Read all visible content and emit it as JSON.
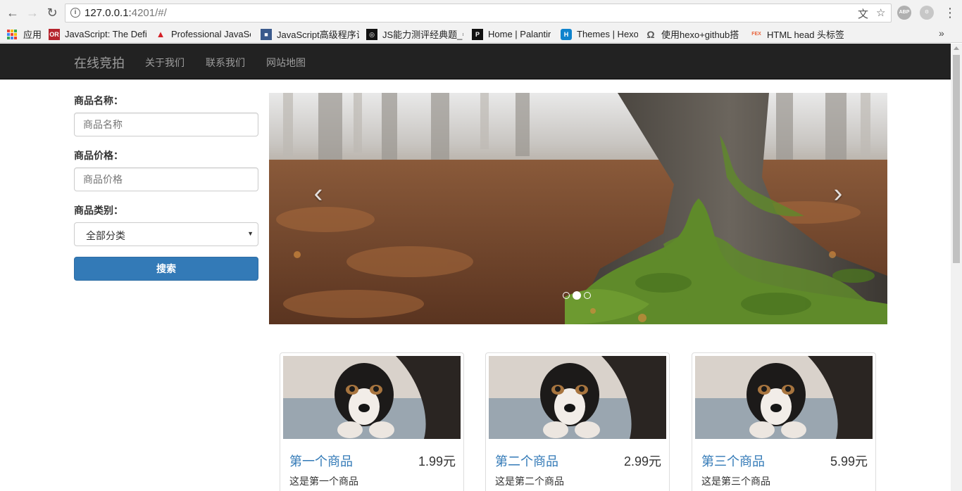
{
  "browser": {
    "url_host": "127.0.0.1:",
    "url_rest": "4201/#/",
    "bookmarks": [
      {
        "label": "应用",
        "icon": "apps-grid-icon"
      },
      {
        "label": "JavaScript: The Defi",
        "icon": "oreilly-icon",
        "color": "#b5242d"
      },
      {
        "label": "Professional JavaSc",
        "icon": "wrox-icon",
        "color": "#d42027"
      },
      {
        "label": "JavaScript高级程序设",
        "icon": "book-icon",
        "color": "#3a5a8c"
      },
      {
        "label": "JS能力测评经典题_牛",
        "icon": "nowcoder-icon",
        "color": "#111111"
      },
      {
        "label": "Home | Palantir",
        "icon": "palantir-icon",
        "color": "#111111"
      },
      {
        "label": "Themes | Hexo",
        "icon": "hexo-icon",
        "color": "#0e83cd"
      },
      {
        "label": "使用hexo+github搭",
        "icon": "omega-icon",
        "color": "#555555"
      },
      {
        "label": "HTML head 头标签",
        "icon": "fex-icon",
        "color": "#e8643c"
      }
    ],
    "fav_text": {
      "oreilly": "OR",
      "palantir": "P",
      "hexo": "H",
      "fex": "FEX",
      "nowcoder": "◎"
    },
    "ext_label": "ABP"
  },
  "navbar": {
    "brand": "在线竞拍",
    "links": [
      "关于我们",
      "联系我们",
      "网站地图"
    ]
  },
  "search_form": {
    "name_label": "商品名称：",
    "name_placeholder": "商品名称",
    "price_label": "商品价格：",
    "price_placeholder": "商品价格",
    "category_label": "商品类别：",
    "category_selected": "全部分类",
    "submit_label": "搜索"
  },
  "carousel": {
    "slide_count": 3,
    "active_index": 1
  },
  "products": [
    {
      "title": "第一个商品",
      "price": "1.99元",
      "desc": "这是第一个商品"
    },
    {
      "title": "第二个商品",
      "price": "2.99元",
      "desc": "这是第二个商品"
    },
    {
      "title": "第三个商品",
      "price": "5.99元",
      "desc": "这是第三个商品"
    }
  ],
  "colors": {
    "navbar_bg": "#222222",
    "primary": "#337ab7",
    "link": "#337ab7"
  }
}
